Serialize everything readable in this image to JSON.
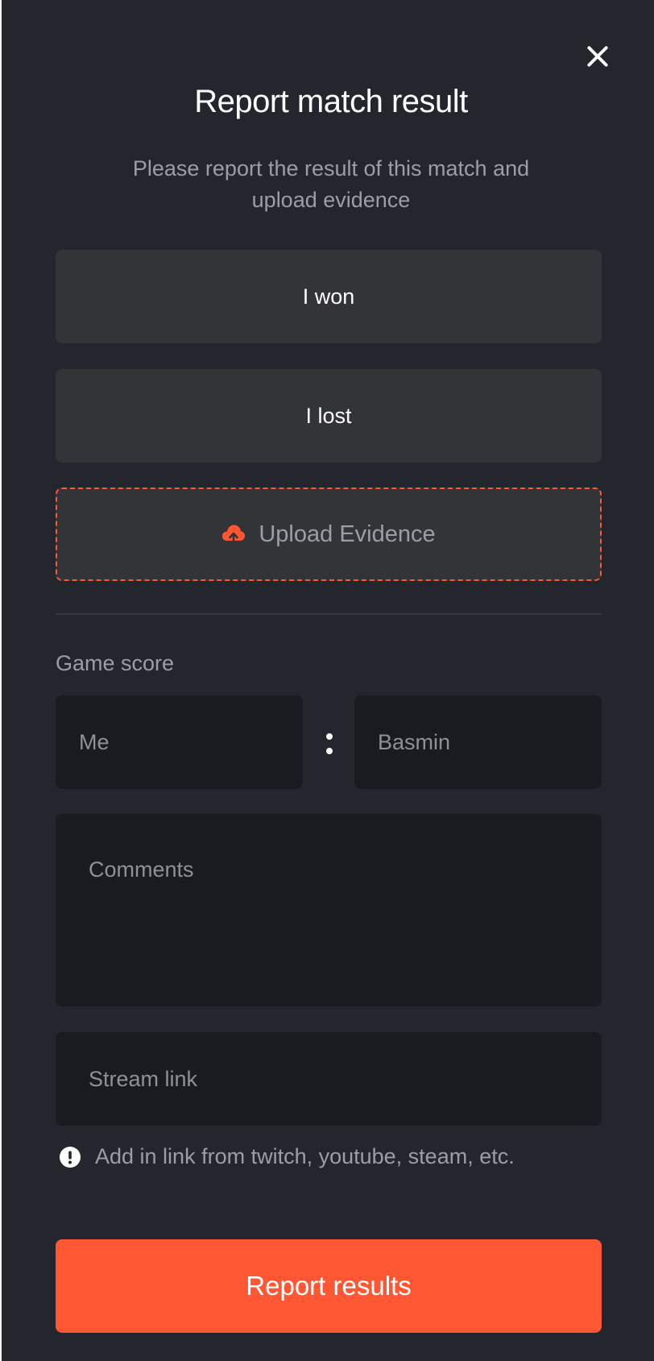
{
  "dialog": {
    "title": "Report match result",
    "subtitle": "Please report the result of this match and upload evidence"
  },
  "choices": {
    "won_label": "I won",
    "lost_label": "I lost"
  },
  "upload": {
    "label": "Upload Evidence",
    "icon": "cloud-upload-icon",
    "accent_color": "#ff5733"
  },
  "score": {
    "label": "Game score",
    "me_placeholder": "Me",
    "opponent_placeholder": "Basmin",
    "separator": ":"
  },
  "comments": {
    "placeholder": "Comments"
  },
  "stream": {
    "placeholder": "Stream link",
    "hint": "Add in link from twitch, youtube, steam, etc.",
    "hint_icon": "exclamation-circle-icon"
  },
  "submit": {
    "label": "Report results",
    "color": "#ff5733"
  }
}
